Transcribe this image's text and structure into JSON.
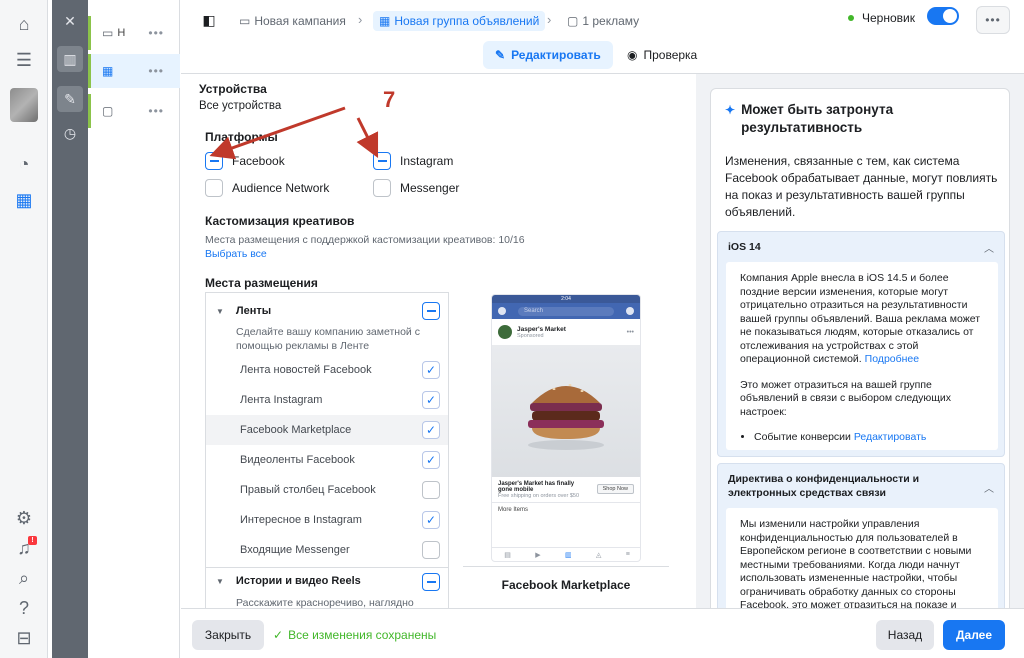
{
  "header": {
    "breadcrumb": [
      {
        "label": "Новая кампания"
      },
      {
        "label": "Новая группа объявлений"
      },
      {
        "label": "1 рекламу"
      }
    ],
    "status": "Черновик",
    "tabs": [
      {
        "label": "Редактировать"
      },
      {
        "label": "Проверка"
      }
    ]
  },
  "tree": {
    "rows": [
      {
        "label": "Н"
      },
      {
        "label": ""
      },
      {
        "label": ""
      }
    ]
  },
  "form": {
    "devices_title": "Устройства",
    "devices_value": "Все устройства",
    "platforms_title": "Платформы",
    "platforms": [
      {
        "label": "Facebook",
        "state": "indeterminate"
      },
      {
        "label": "Instagram",
        "state": "indeterminate"
      },
      {
        "label": "Audience Network",
        "state": "unchecked"
      },
      {
        "label": "Messenger",
        "state": "unchecked"
      }
    ],
    "creative_title": "Кастомизация креативов",
    "creative_desc": "Места размещения с поддержкой кастомизации креативов: 10/16",
    "creative_link": "Выбрать все",
    "placements_title": "Места размещения",
    "feeds_group": "Ленты",
    "feeds_desc": "Сделайте вашу компанию заметной с помощью рекламы в Ленте",
    "placements": [
      {
        "label": "Лента новостей Facebook",
        "checked": true
      },
      {
        "label": "Лента Instagram",
        "checked": true
      },
      {
        "label": "Facebook Marketplace",
        "checked": true
      },
      {
        "label": "Видеоленты Facebook",
        "checked": true
      },
      {
        "label": "Правый столбец Facebook",
        "checked": false
      },
      {
        "label": "Интересное в Instagram",
        "checked": true
      },
      {
        "label": "Входящие Messenger",
        "checked": false
      }
    ],
    "stories_group": "Истории и видео Reels",
    "stories_desc": "Расскажите красноречиво, наглядно"
  },
  "preview": {
    "status_time": "2:04",
    "search_placeholder": "Search",
    "page_name": "Jasper's Market",
    "sponsored": "Sponsored",
    "caption": "Jasper's Market has finally gone mobile",
    "caption_sub": "Free shipping on orders over $50",
    "shop_button": "Shop Now",
    "more_items": "More Items",
    "title": "Facebook Marketplace"
  },
  "annotation": {
    "number": "7",
    "color": "#c0392b"
  },
  "info": {
    "title": "Может быть затронута результативность",
    "body": "Изменения, связанные с тем, как система Facebook обрабатывает данные, могут повлиять на показ и результативность вашей группы объявлений.",
    "ios": {
      "header": "iOS 14",
      "p1": "Компания Apple внесла в iOS 14.5 и более поздние версии изменения, которые могут отрицательно отразиться на результативности вашей группы объявлений. Ваша реклама может не показываться людям, которые отказались от отслеживания на устройствах с этой операционной системой.",
      "p1_link": "Подробнее",
      "p2": "Это может отразиться на вашей группе объявлений в связи с выбором следующих настроек:",
      "bullet": "Событие конверсии",
      "bullet_link": "Редактировать"
    },
    "privacy": {
      "header": "Директива о конфиденциальности и электронных средствах связи",
      "p1": "Мы изменили настройки управления конфиденциальностью для пользователей в Европейском регионе в соответствии с новыми местными требованиями. Когда люди начнут использовать измененные настройки, чтобы ограничивать обработку данных со стороны Facebook, это может отразиться на показе и"
    }
  },
  "footer": {
    "close": "Закрыть",
    "saved": "Все изменения сохранены",
    "back": "Назад",
    "next": "Далее"
  },
  "colors": {
    "accent": "#1877f2",
    "success": "#42b72a"
  }
}
